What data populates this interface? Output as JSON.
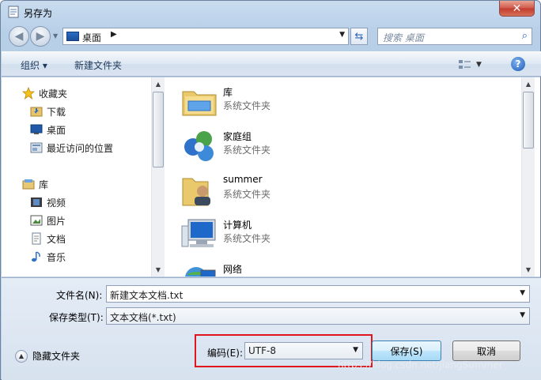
{
  "window": {
    "title": "另存为",
    "close_label": "✕"
  },
  "nav": {
    "back_icon": "back-arrow-icon",
    "forward_icon": "forward-arrow-icon",
    "address": "桌面",
    "search_placeholder": "搜索 桌面"
  },
  "toolbar": {
    "organize": "组织 ▾",
    "new_folder": "新建文件夹"
  },
  "sidebar": {
    "favorites": "收藏夹",
    "favorites_items": [
      "下载",
      "桌面",
      "最近访问的位置"
    ],
    "libraries": "库",
    "library_items": [
      "视频",
      "图片",
      "文档",
      "音乐"
    ]
  },
  "files": [
    {
      "name": "库",
      "type": "系统文件夹",
      "icon": "library-icon"
    },
    {
      "name": "家庭组",
      "type": "系统文件夹",
      "icon": "homegroup-icon"
    },
    {
      "name": "summer",
      "type": "系统文件夹",
      "icon": "user-folder-icon"
    },
    {
      "name": "计算机",
      "type": "系统文件夹",
      "icon": "computer-icon"
    },
    {
      "name": "网络",
      "type": "",
      "icon": "network-icon"
    }
  ],
  "form": {
    "filename_label": "文件名(N):",
    "filename_value": "新建文本文档.txt",
    "savetype_label": "保存类型(T):",
    "savetype_value": "文本文档(*.txt)",
    "encoding_label": "编码(E):",
    "encoding_value": "UTF-8",
    "save_button": "保存(S)",
    "cancel_button": "取消",
    "hide_folders": "隐藏文件夹"
  },
  "watermark": "https://blog.csdn.net/jiangSummer",
  "colors": {
    "highlight_box": "#e0161c",
    "primary_button": "#bee6fd"
  }
}
